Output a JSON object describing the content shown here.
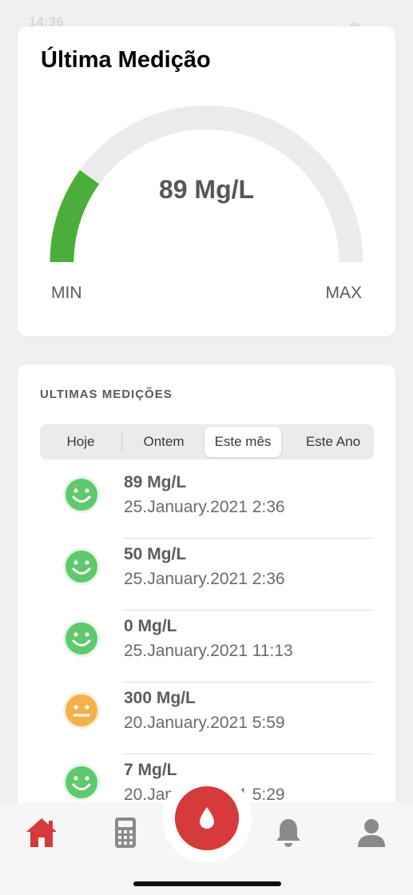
{
  "status_bar": {
    "time": "14:36"
  },
  "gauge": {
    "title": "Última Medição",
    "value": "89 Mg/L",
    "min_label": "MIN",
    "max_label": "MAX",
    "level": 0.2,
    "fill_color": "#4cae3a",
    "track_color": "#ebebeb"
  },
  "history": {
    "title": "ULTIMAS MEDIÇÕES",
    "tabs": [
      {
        "label": "Hoje"
      },
      {
        "label": "Ontem"
      },
      {
        "label": "Este mês"
      },
      {
        "label": "Este Ano"
      }
    ],
    "selected_tab": "Este mês",
    "items": [
      {
        "value": "89 Mg/L",
        "date": "25.January.2021 2:36",
        "mood": "happy-face-icon"
      },
      {
        "value": "50 Mg/L",
        "date": "25.January.2021 2:36",
        "mood": "happy-face-icon"
      },
      {
        "value": "0 Mg/L",
        "date": "25.January.2021 11:13",
        "mood": "happy-face-icon"
      },
      {
        "value": "300 Mg/L",
        "date": "20.January.2021 5:59",
        "mood": "neutral-face-icon"
      },
      {
        "value": "7 Mg/L",
        "date": "20.January.2021 5:29",
        "mood": "happy-face-icon"
      }
    ]
  },
  "tab_bar": {
    "items": [
      "home-icon",
      "calculator-icon",
      "blood-drop-icon",
      "bell-icon",
      "profile-icon"
    ],
    "active": "home-icon",
    "accent_color": "#d63a3a"
  }
}
